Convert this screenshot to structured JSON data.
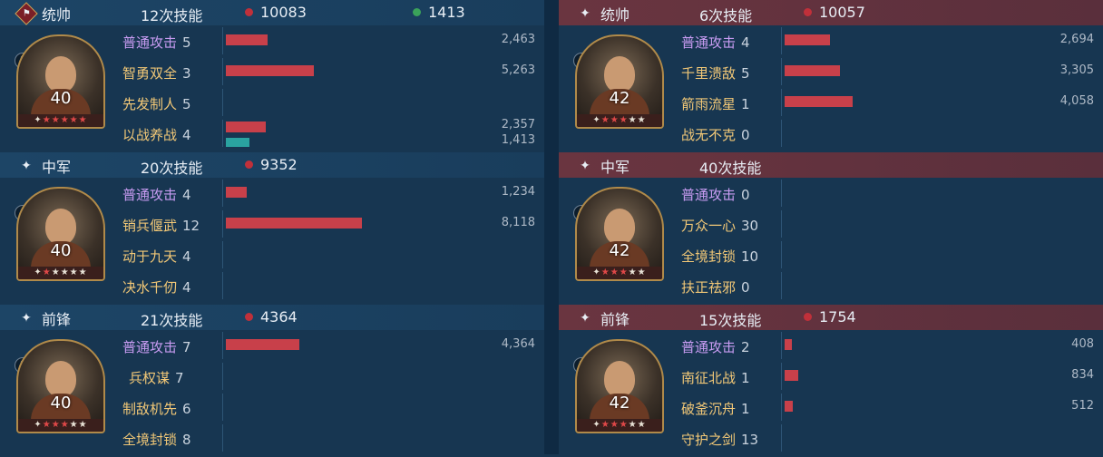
{
  "left": [
    {
      "role": "统帅",
      "role_icon": "flag-icon",
      "count": "12次技能",
      "damage": "10083",
      "heal": "1413",
      "level": "40",
      "stars_on": 5,
      "unit_icon": "cavalry-icon",
      "skills": [
        {
          "name": "普通攻击",
          "lv": "5",
          "basic": true,
          "value": "2,463",
          "bar": 2463
        },
        {
          "name": "智勇双全",
          "lv": "3",
          "value": "5,263",
          "bar": 5263
        },
        {
          "name": "先发制人",
          "lv": "5",
          "value": "",
          "bar": 0
        },
        {
          "name": "以战养战",
          "lv": "4",
          "value": "2,357",
          "bar": 2357,
          "value2": "1,413",
          "bar2": 1413
        }
      ]
    },
    {
      "role": "中军",
      "role_icon": "sparkle-icon",
      "count": "20次技能",
      "damage": "9352",
      "heal": "",
      "level": "40",
      "stars_on": 1,
      "unit_icon": "spear-icon",
      "skills": [
        {
          "name": "普通攻击",
          "lv": "4",
          "basic": true,
          "value": "1,234",
          "bar": 1234
        },
        {
          "name": "销兵偃武",
          "lv": "12",
          "value": "8,118",
          "bar": 8118
        },
        {
          "name": "动于九天",
          "lv": "4",
          "value": "",
          "bar": 0
        },
        {
          "name": "决水千仞",
          "lv": "4",
          "value": "",
          "bar": 0
        }
      ]
    },
    {
      "role": "前锋",
      "role_icon": "sparkle-icon",
      "count": "21次技能",
      "damage": "4364",
      "heal": "",
      "level": "40",
      "stars_on": 3,
      "unit_icon": "cavalry-icon",
      "skills": [
        {
          "name": "普通攻击",
          "lv": "7",
          "basic": true,
          "value": "4,364",
          "bar": 4364
        },
        {
          "name": "兵权谋",
          "lv": "7",
          "value": "",
          "bar": 0,
          "indent": true
        },
        {
          "name": "制敌机先",
          "lv": "6",
          "value": "",
          "bar": 0
        },
        {
          "name": "全境封锁",
          "lv": "8",
          "value": "",
          "bar": 0
        }
      ]
    }
  ],
  "right": [
    {
      "role": "统帅",
      "role_icon": "sparkle-icon",
      "count": "6次技能",
      "damage": "10057",
      "heal": "",
      "level": "42",
      "stars_on": 3,
      "unit_icon": "cavalry-icon",
      "skills": [
        {
          "name": "普通攻击",
          "lv": "4",
          "basic": true,
          "value": "2,694",
          "bar": 2694
        },
        {
          "name": "千里溃敌",
          "lv": "5",
          "value": "3,305",
          "bar": 3305
        },
        {
          "name": "箭雨流星",
          "lv": "1",
          "value": "4,058",
          "bar": 4058
        },
        {
          "name": "战无不克",
          "lv": "0",
          "value": "",
          "bar": 0
        }
      ]
    },
    {
      "role": "中军",
      "role_icon": "sparkle-icon",
      "count": "40次技能",
      "damage": "",
      "heal": "",
      "level": "42",
      "stars_on": 3,
      "unit_icon": "cavalry-icon",
      "skills": [
        {
          "name": "普通攻击",
          "lv": "0",
          "basic": true,
          "value": "",
          "bar": 0
        },
        {
          "name": "万众一心",
          "lv": "30",
          "value": "",
          "bar": 0
        },
        {
          "name": "全境封锁",
          "lv": "10",
          "value": "",
          "bar": 0
        },
        {
          "name": "扶正祛邪",
          "lv": "0",
          "value": "",
          "bar": 0
        }
      ]
    },
    {
      "role": "前锋",
      "role_icon": "sparkle-icon",
      "count": "15次技能",
      "damage": "1754",
      "heal": "",
      "level": "42",
      "stars_on": 3,
      "unit_icon": "cavalry-icon",
      "skills": [
        {
          "name": "普通攻击",
          "lv": "2",
          "basic": true,
          "value": "408",
          "bar": 408
        },
        {
          "name": "南征北战",
          "lv": "1",
          "value": "834",
          "bar": 834
        },
        {
          "name": "破釜沉舟",
          "lv": "1",
          "value": "512",
          "bar": 512
        },
        {
          "name": "守护之剑",
          "lv": "13",
          "value": "",
          "bar": 0
        }
      ]
    }
  ],
  "bar_max": 8118
}
